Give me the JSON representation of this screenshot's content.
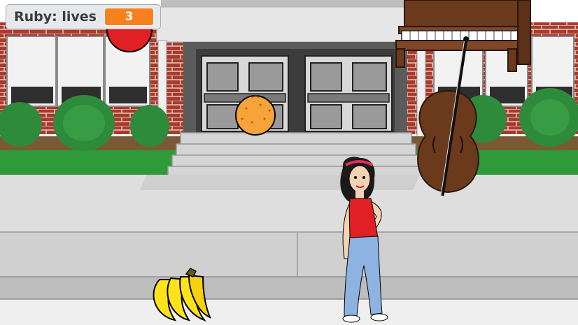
{
  "lives_monitor": {
    "label": "Ruby: lives",
    "value": "3"
  },
  "colors": {
    "sky": "#ffffff",
    "brick": "#a83a2e",
    "building": "#e3e3e3",
    "grass": "#2f9a3a",
    "sidewalk": "#d6d6d6",
    "monitor_accent": "#f7811f",
    "orange": "#f6a33a",
    "ball": "#e02024",
    "banana": "#ffe31a",
    "wood": "#6b3a1d"
  },
  "sprites": [
    {
      "name": "ruby",
      "icon": "girl-character"
    },
    {
      "name": "orange",
      "icon": "orange-fruit"
    },
    {
      "name": "ball",
      "icon": "red-ball"
    },
    {
      "name": "bananas",
      "icon": "banana-bunch"
    },
    {
      "name": "piano",
      "icon": "upright-piano"
    },
    {
      "name": "cello",
      "icon": "cello"
    }
  ]
}
